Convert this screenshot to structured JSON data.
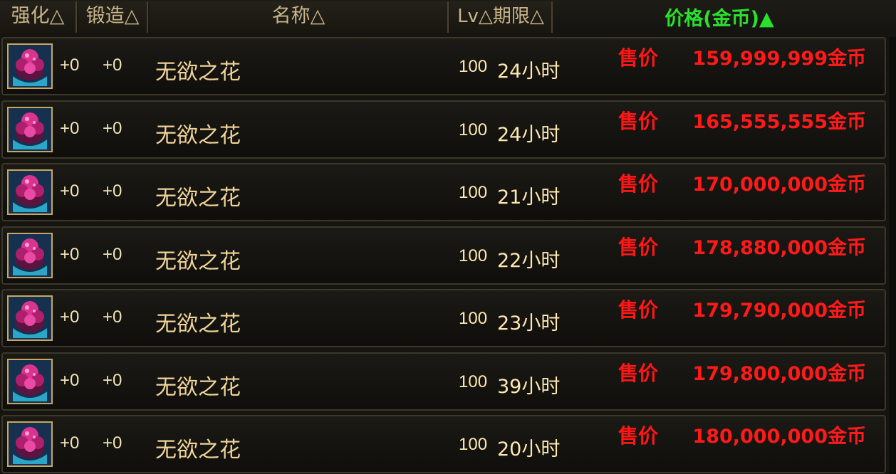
{
  "header": {
    "enhance": "强化△",
    "forge": "锻造△",
    "name": "名称△",
    "lv_period": "Lv△期限△",
    "price": "价格(金币)▲"
  },
  "items": [
    {
      "enhance": "+0",
      "forge": "+0",
      "name": "无欲之花",
      "lv": "100",
      "period": "24小时",
      "sale_label": "售价",
      "price": "159,999,999金币",
      "icon": "flower-item-icon"
    },
    {
      "enhance": "+0",
      "forge": "+0",
      "name": "无欲之花",
      "lv": "100",
      "period": "24小时",
      "sale_label": "售价",
      "price": "165,555,555金币",
      "icon": "flower-item-icon"
    },
    {
      "enhance": "+0",
      "forge": "+0",
      "name": "无欲之花",
      "lv": "100",
      "period": "21小时",
      "sale_label": "售价",
      "price": "170,000,000金币",
      "icon": "flower-item-icon"
    },
    {
      "enhance": "+0",
      "forge": "+0",
      "name": "无欲之花",
      "lv": "100",
      "period": "22小时",
      "sale_label": "售价",
      "price": "178,880,000金币",
      "icon": "flower-item-icon"
    },
    {
      "enhance": "+0",
      "forge": "+0",
      "name": "无欲之花",
      "lv": "100",
      "period": "23小时",
      "sale_label": "售价",
      "price": "179,790,000金币",
      "icon": "flower-item-icon"
    },
    {
      "enhance": "+0",
      "forge": "+0",
      "name": "无欲之花",
      "lv": "100",
      "period": "39小时",
      "sale_label": "售价",
      "price": "179,800,000金币",
      "icon": "flower-item-icon"
    },
    {
      "enhance": "+0",
      "forge": "+0",
      "name": "无欲之花",
      "lv": "100",
      "period": "20小时",
      "sale_label": "售价",
      "price": "180,000,000金币",
      "icon": "flower-item-icon"
    }
  ],
  "colors": {
    "price_text": "#ff1a1a",
    "active_sort": "#29e02c",
    "header_text": "#c9b58a",
    "item_name": "#f0d49a"
  }
}
